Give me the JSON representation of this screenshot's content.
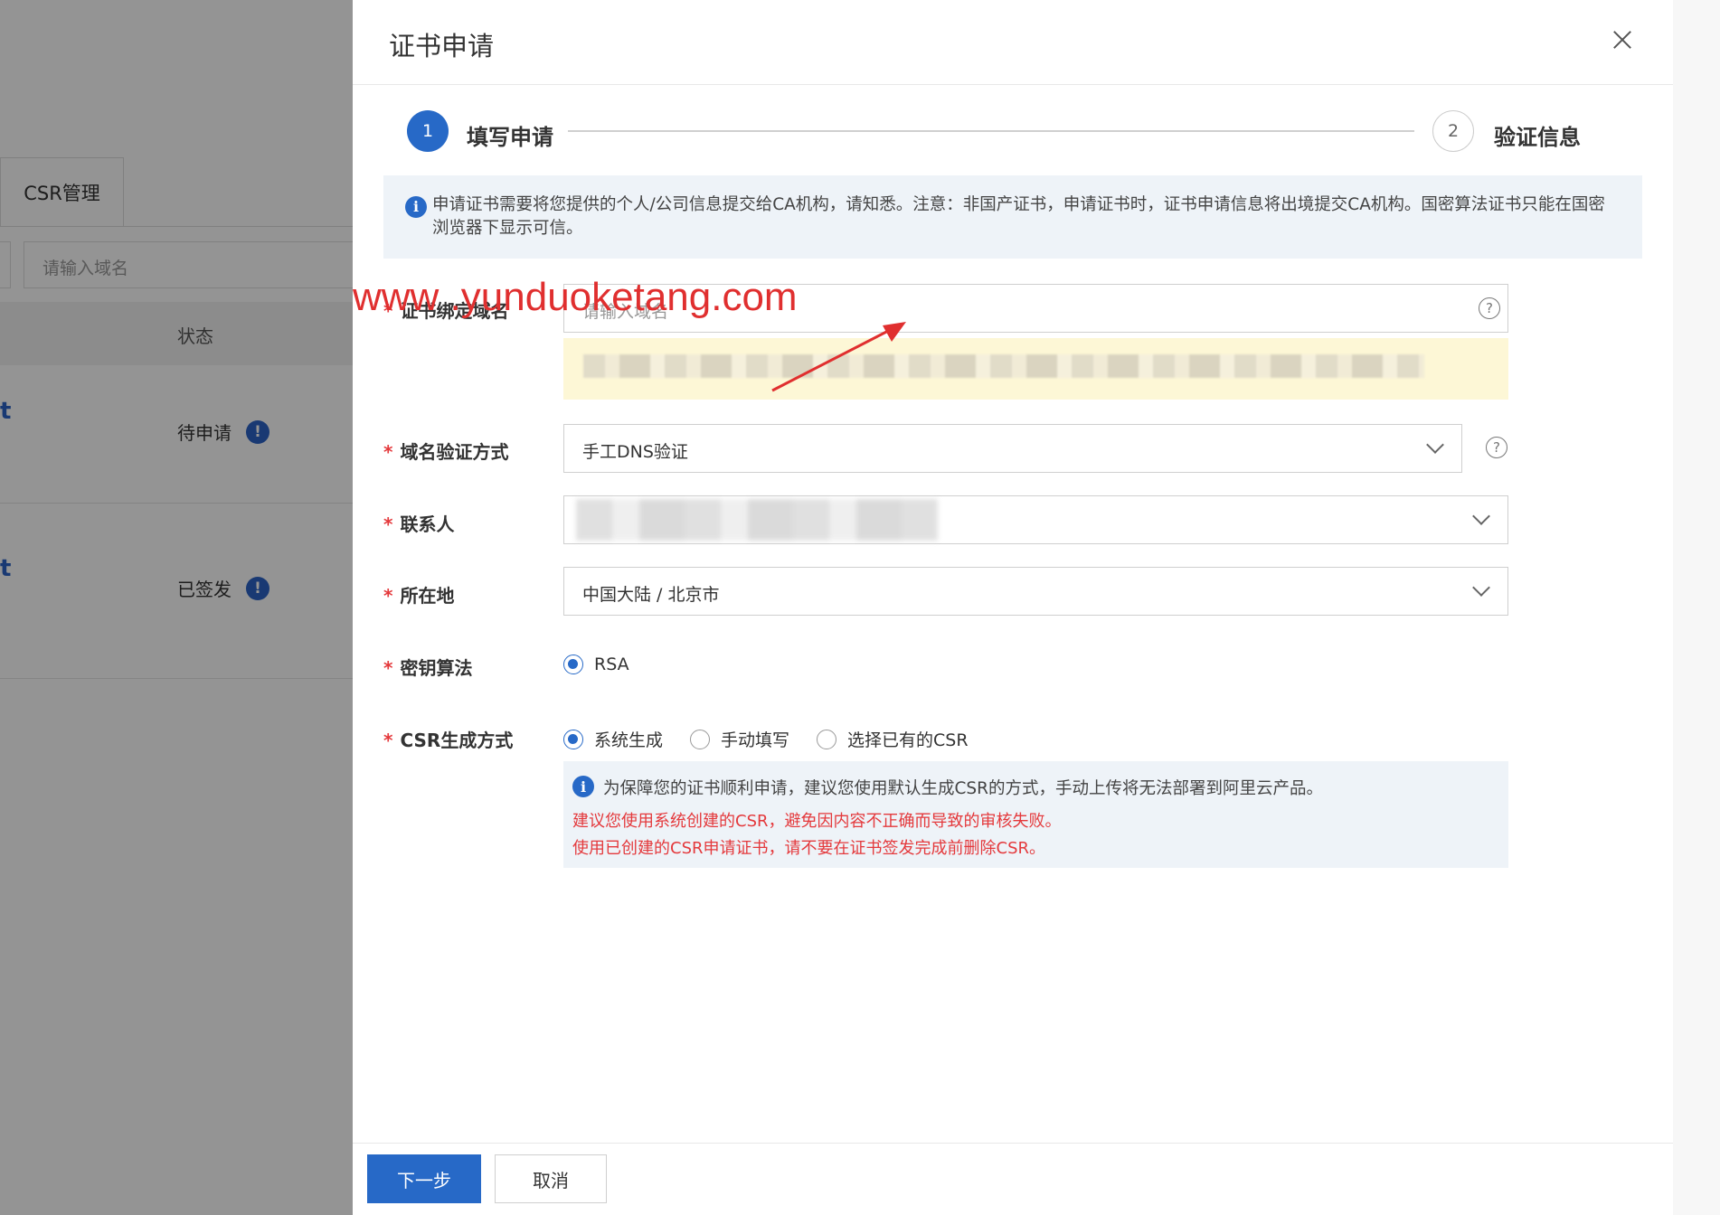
{
  "background": {
    "tab_label": "CSR管理",
    "search_placeholder": "请输入域名",
    "table_header_status": "状态",
    "rows": [
      {
        "brand_fragment": "t",
        "status": "待申请"
      },
      {
        "brand_fragment": "t",
        "status": "已签发"
      }
    ]
  },
  "dialog": {
    "title": "证书申请",
    "steps": [
      {
        "number": "1",
        "label": "填写申请"
      },
      {
        "number": "2",
        "label": "验证信息"
      }
    ],
    "notice": "申请证书需要将您提供的个人/公司信息提交给CA机构，请知悉。注意：非国产证书，申请证书时，证书申请信息将出境提交CA机构。国密算法证书只能在国密浏览器下显示可信。",
    "fields": {
      "domain": {
        "label": "证书绑定域名",
        "placeholder": "请输入域名"
      },
      "verify_method": {
        "label": "域名验证方式",
        "value": "手工DNS验证"
      },
      "contact": {
        "label": "联系人"
      },
      "location": {
        "label": "所在地",
        "value": "中国大陆 / 北京市"
      },
      "key_algo": {
        "label": "密钥算法",
        "options": [
          "RSA"
        ]
      },
      "csr_method": {
        "label": "CSR生成方式",
        "options": [
          "系统生成",
          "手动填写",
          "选择已有的CSR"
        ]
      }
    },
    "csr_tip": {
      "main": "为保障您的证书顺利申请，建议您使用默认生成CSR的方式，手动上传将无法部署到阿里云产品。",
      "red1": "建议您使用系统创建的CSR，避免因内容不正确而导致的审核失败。",
      "red2": "使用已创建的CSR申请证书，请不要在证书签发完成前删除CSR。"
    },
    "buttons": {
      "next": "下一步",
      "cancel": "取消"
    },
    "watermark": "www .yunduoketang.com"
  },
  "colors": {
    "primary": "#2769c7",
    "required": "#e4393c",
    "watermark": "#e02f2f"
  }
}
